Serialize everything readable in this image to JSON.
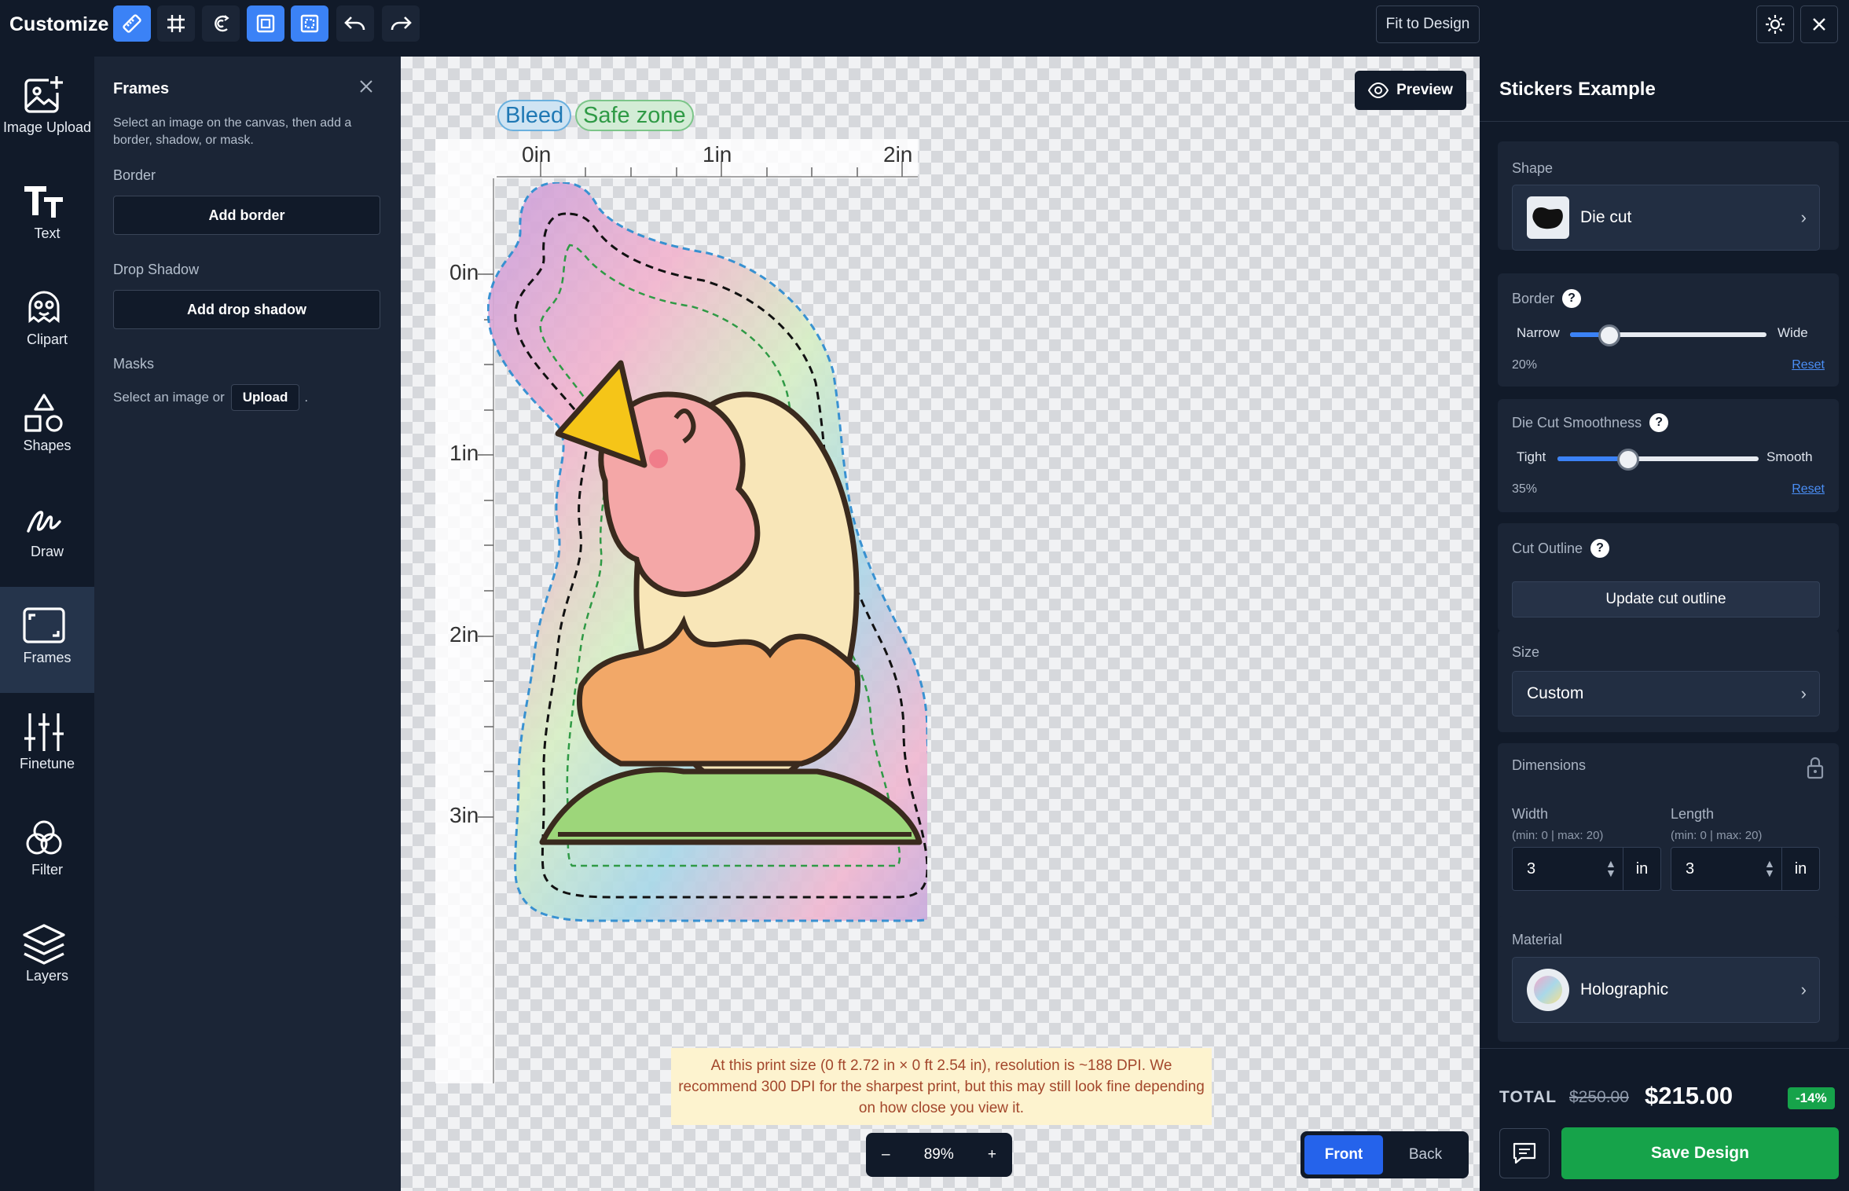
{
  "app": {
    "title": "Customize"
  },
  "toolbar": {
    "fit_label": "Fit to Design"
  },
  "rail": [
    {
      "label": "Image Upload",
      "icon": "image-upload-icon"
    },
    {
      "label": "Text",
      "icon": "text-icon"
    },
    {
      "label": "Clipart",
      "icon": "clipart-icon"
    },
    {
      "label": "Shapes",
      "icon": "shapes-icon"
    },
    {
      "label": "Draw",
      "icon": "draw-icon"
    },
    {
      "label": "Frames",
      "icon": "frames-icon"
    },
    {
      "label": "Finetune",
      "icon": "finetune-icon"
    },
    {
      "label": "Filter",
      "icon": "filter-icon"
    },
    {
      "label": "Layers",
      "icon": "layers-icon"
    }
  ],
  "frames": {
    "title": "Frames",
    "description": "Select an image on the canvas, then add a border, shadow, or mask.",
    "border_label": "Border",
    "add_border": "Add border",
    "shadow_label": "Drop Shadow",
    "add_shadow": "Add drop shadow",
    "masks_label": "Masks",
    "masks_text": "Select an image or",
    "upload_label": "Upload",
    "masks_suffix": "."
  },
  "canvas": {
    "preview_label": "Preview",
    "bleed_label": "Bleed",
    "safe_label": "Safe zone",
    "ruler_h": [
      "0in",
      "1in",
      "2in"
    ],
    "ruler_v": [
      "0in",
      "1in",
      "2in",
      "3in"
    ],
    "dpi_note": "At this print size (0 ft 2.72 in × 0 ft 2.54 in), resolution is ~188 DPI. We recommend 300 DPI for the sharpest print, but this may still look fine depending on how close you view it.",
    "zoom_minus": "–",
    "zoom_value": "89%",
    "zoom_plus": "+",
    "front_label": "Front",
    "back_label": "Back"
  },
  "right": {
    "title": "Stickers Example",
    "shape_label": "Shape",
    "shape_value": "Die cut",
    "border_label": "Border",
    "border_min": "Narrow",
    "border_max": "Wide",
    "border_pct": "20%",
    "border_level": 0.2,
    "reset_label": "Reset",
    "smooth_label": "Die Cut Smoothness",
    "smooth_min": "Tight",
    "smooth_max": "Smooth",
    "smooth_pct": "35%",
    "smooth_level": 0.35,
    "outline_label": "Cut Outline",
    "outline_btn": "Update cut outline",
    "size_label": "Size",
    "size_value": "Custom",
    "dim_label": "Dimensions",
    "width_label": "Width",
    "width_hint": "(min: 0 | max: 20)",
    "width_value": "3",
    "length_label": "Length",
    "length_hint": "(min: 0 | max: 20)",
    "length_value": "3",
    "unit": "in",
    "material_label": "Material",
    "material_value": "Holographic"
  },
  "footer": {
    "total_label": "TOTAL",
    "old_price": "$250.00",
    "new_price": "$215.00",
    "discount": "-14%",
    "save_label": "Save Design"
  },
  "colors": {
    "accent": "#3b82f6",
    "save": "#16a34a",
    "panel": "#1b2536",
    "dark": "#111a29"
  }
}
